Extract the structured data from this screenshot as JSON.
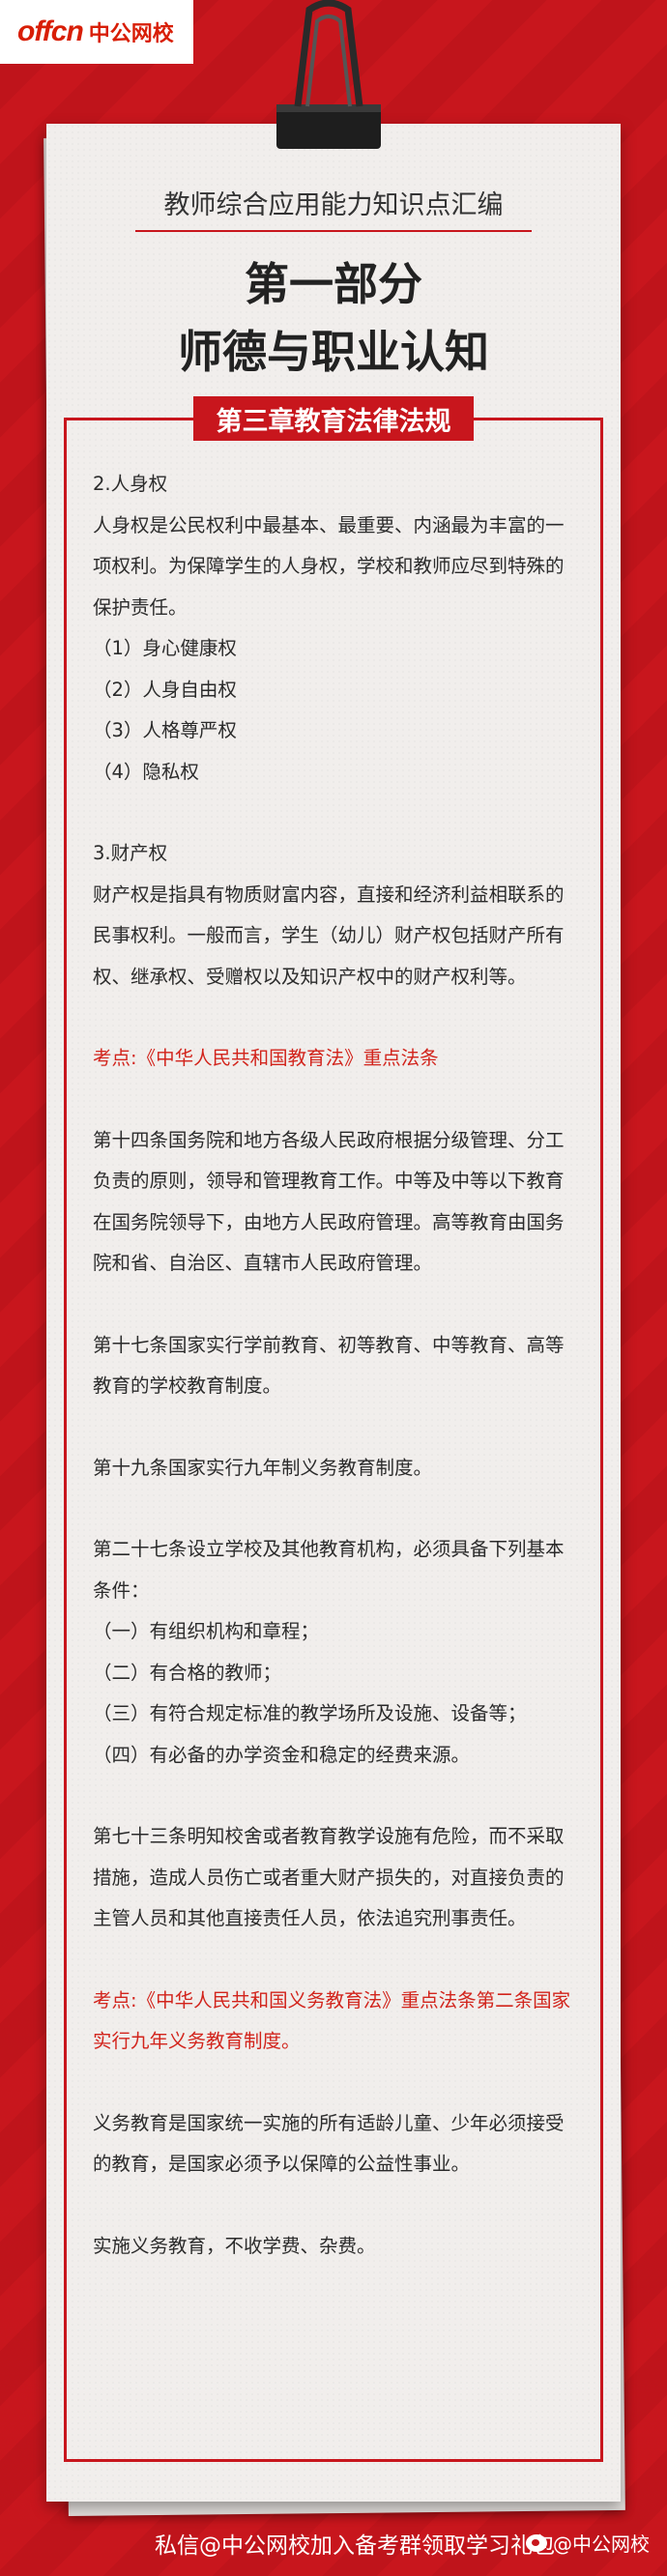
{
  "brand": {
    "logo_mark": "offcn",
    "logo_name": "中公网校"
  },
  "header": {
    "subtitle": "教师综合应用能力知识点汇编",
    "title_line1": "第一部分",
    "title_line2": "师德与职业认知",
    "chapter": "第三章教育法律法规"
  },
  "content": {
    "p01": "2.人身权",
    "p02": "人身权是公民权利中最基本、最重要、内涵最为丰富的一项权利。为保障学生的人身权，学校和教师应尽到特殊的保护责任。",
    "p03": "（1）身心健康权",
    "p04": "（2）人身自由权",
    "p05": "（3）人格尊严权",
    "p06": "（4）隐私权",
    "p07": "3.财产权",
    "p08": "财产权是指具有物质财富内容，直接和经济利益相联系的民事权利。一般而言，学生（幼儿）财产权包括财产所有权、继承权、受赠权以及知识产权中的财产权利等。",
    "p09": "考点:《中华人民共和国教育法》重点法条",
    "p10": "第十四条国务院和地方各级人民政府根据分级管理、分工负责的原则，领导和管理教育工作。中等及中等以下教育在国务院领导下，由地方人民政府管理。高等教育由国务院和省、自治区、直辖市人民政府管理。",
    "p11": "第十七条国家实行学前教育、初等教育、中等教育、高等教育的学校教育制度。",
    "p12": "第十九条国家实行九年制义务教育制度。",
    "p13": "第二十七条设立学校及其他教育机构，必须具备下列基本条件：",
    "p14": "（一）有组织机构和章程；",
    "p15": "（二）有合格的教师；",
    "p16": "（三）有符合规定标准的教学场所及设施、设备等；",
    "p17": "（四）有必备的办学资金和稳定的经费来源。",
    "p18": "第七十三条明知校舍或者教育教学设施有危险，而不采取措施，造成人员伤亡或者重大财产损失的，对直接负责的主管人员和其他直接责任人员，依法追究刑事责任。",
    "p19": "考点:《中华人民共和国义务教育法》重点法条第二条国家实行九年义务教育制度。",
    "p20": "义务教育是国家统一实施的所有适龄儿童、少年必须接受的教育，是国家必须予以保障的公益性事业。",
    "p21": "实施义务教育，不收学费、杂费。"
  },
  "footer": {
    "promo": "私信@中公网校加入备考群领取学习礼包",
    "weibo": "@中公网校"
  },
  "colors": {
    "brand_red": "#c8161d",
    "highlight_red": "#d2241c",
    "paper": "#f1eeec"
  }
}
